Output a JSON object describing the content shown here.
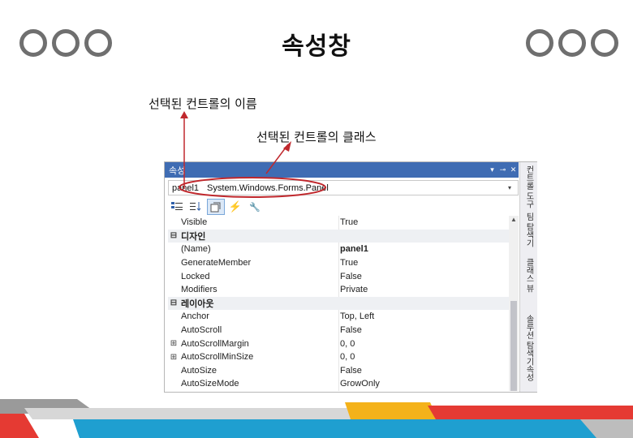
{
  "slide": {
    "title": "속성창",
    "callout_name": "선택된 컨트롤의 이름",
    "callout_class": "선택된 컨트롤의 클래스"
  },
  "window": {
    "title": "속성",
    "pin_glyph": "▾ ⊸ ✕",
    "object_name": "panel1",
    "object_class": "System.Windows.Forms.Panel",
    "dropdown_glyph": "▾",
    "toolbar": [
      "categorized",
      "alphabetical",
      "properties",
      "events",
      "property-pages"
    ]
  },
  "properties": [
    {
      "type": "prop",
      "name": "Visible",
      "value": "True"
    },
    {
      "type": "cat",
      "expander": "⊟",
      "name": "디자인"
    },
    {
      "type": "prop",
      "name": "(Name)",
      "value": "panel1",
      "bold": true
    },
    {
      "type": "prop",
      "name": "GenerateMember",
      "value": "True"
    },
    {
      "type": "prop",
      "name": "Locked",
      "value": "False"
    },
    {
      "type": "prop",
      "name": "Modifiers",
      "value": "Private"
    },
    {
      "type": "cat",
      "expander": "⊟",
      "name": "레이아웃"
    },
    {
      "type": "prop",
      "name": "Anchor",
      "value": "Top, Left"
    },
    {
      "type": "prop",
      "name": "AutoScroll",
      "value": "False"
    },
    {
      "type": "prop",
      "expander": "⊞",
      "name": "AutoScrollMargin",
      "value": "0, 0"
    },
    {
      "type": "prop",
      "expander": "⊞",
      "name": "AutoScrollMinSize",
      "value": "0, 0"
    },
    {
      "type": "prop",
      "name": "AutoSize",
      "value": "False"
    },
    {
      "type": "prop",
      "name": "AutoSizeMode",
      "value": "GrowOnly"
    }
  ],
  "side_tabs": [
    "컨트롤 도구",
    "팀 탐색기",
    "클래스 뷰",
    "솔루션 탐색기",
    "속성"
  ],
  "colors": {
    "titlebar": "#3f6cb3",
    "callout_mark": "#c0282d",
    "stripe_red": "#e53a33",
    "stripe_blue": "#1f9fd0",
    "stripe_yellow": "#f4b21a",
    "stripe_gray": "#9a9a9a"
  }
}
